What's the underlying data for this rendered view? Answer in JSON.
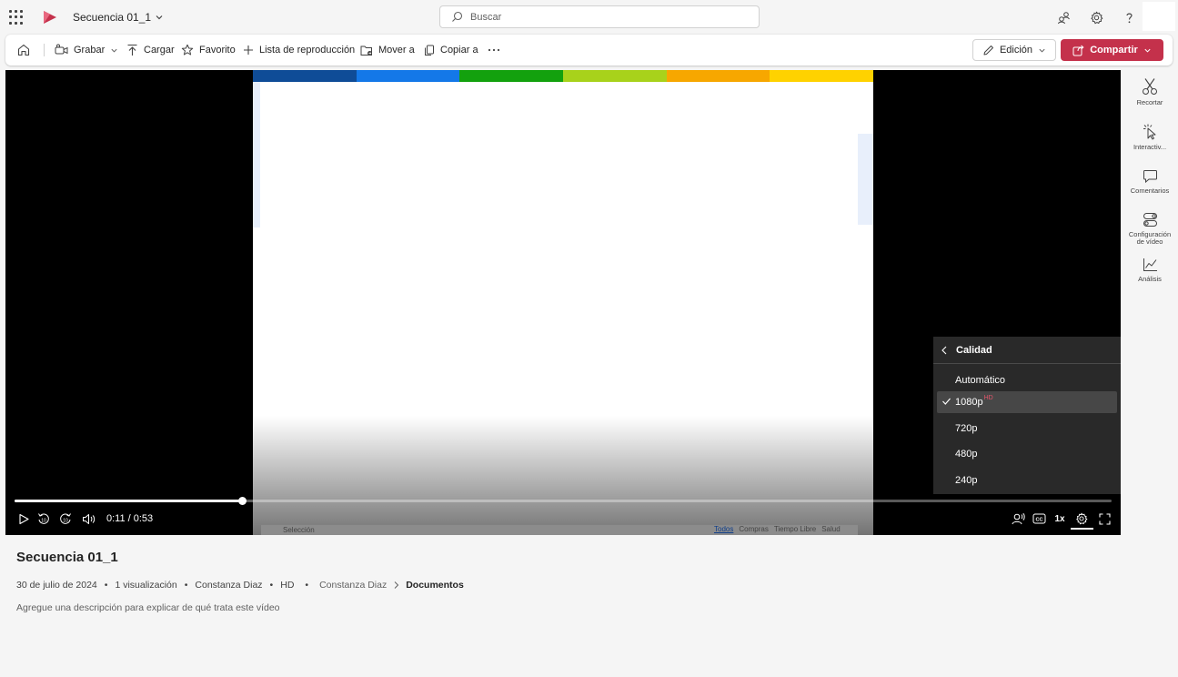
{
  "app": {
    "document_title": "Secuencia 01_1",
    "search_placeholder": "Buscar"
  },
  "toolbar": {
    "record": "Grabar",
    "upload": "Cargar",
    "favorite": "Favorito",
    "playlist": "Lista de reproducción",
    "move": "Mover a",
    "copy": "Copiar a",
    "edit": "Edición",
    "share": "Compartir"
  },
  "player": {
    "time": "0:11 / 0:53",
    "progress_fraction": 0.2075,
    "speed": "1x",
    "stripe_colors": [
      "#0f4c97",
      "#1478e8",
      "#13a10e",
      "#a8d21b",
      "#f7a700",
      "#ffd200"
    ],
    "frame_bottom_left": "Selección",
    "frame_bottom_tabs": [
      "Todos",
      "Compras",
      "Tiempo Libre",
      "Salud"
    ]
  },
  "quality_menu": {
    "title": "Calidad",
    "options": [
      {
        "label": "Automático",
        "selected": false,
        "badge": ""
      },
      {
        "label": "1080p",
        "selected": true,
        "badge": "HD"
      },
      {
        "label": "720p",
        "selected": false,
        "badge": ""
      },
      {
        "label": "480p",
        "selected": false,
        "badge": ""
      },
      {
        "label": "240p",
        "selected": false,
        "badge": ""
      }
    ]
  },
  "rail": {
    "trim": "Recortar",
    "interactive": "Interactiv...",
    "comments": "Comentarios",
    "video_settings_1": "Configuración",
    "video_settings_2": "de vídeo",
    "analytics": "Análisis"
  },
  "video_info": {
    "title": "Secuencia 01_1",
    "date": "30 de julio de 2024",
    "views": "1 visualización",
    "owner": "Constanza Diaz",
    "quality": "HD",
    "breadcrumb_owner": "Constanza Diaz",
    "breadcrumb_folder": "Documentos",
    "description_placeholder": "Agregue una descripción para explicar de qué trata este vídeo"
  },
  "colors": {
    "share_button": "#c4314b",
    "hd_badge": "#e3566b"
  }
}
